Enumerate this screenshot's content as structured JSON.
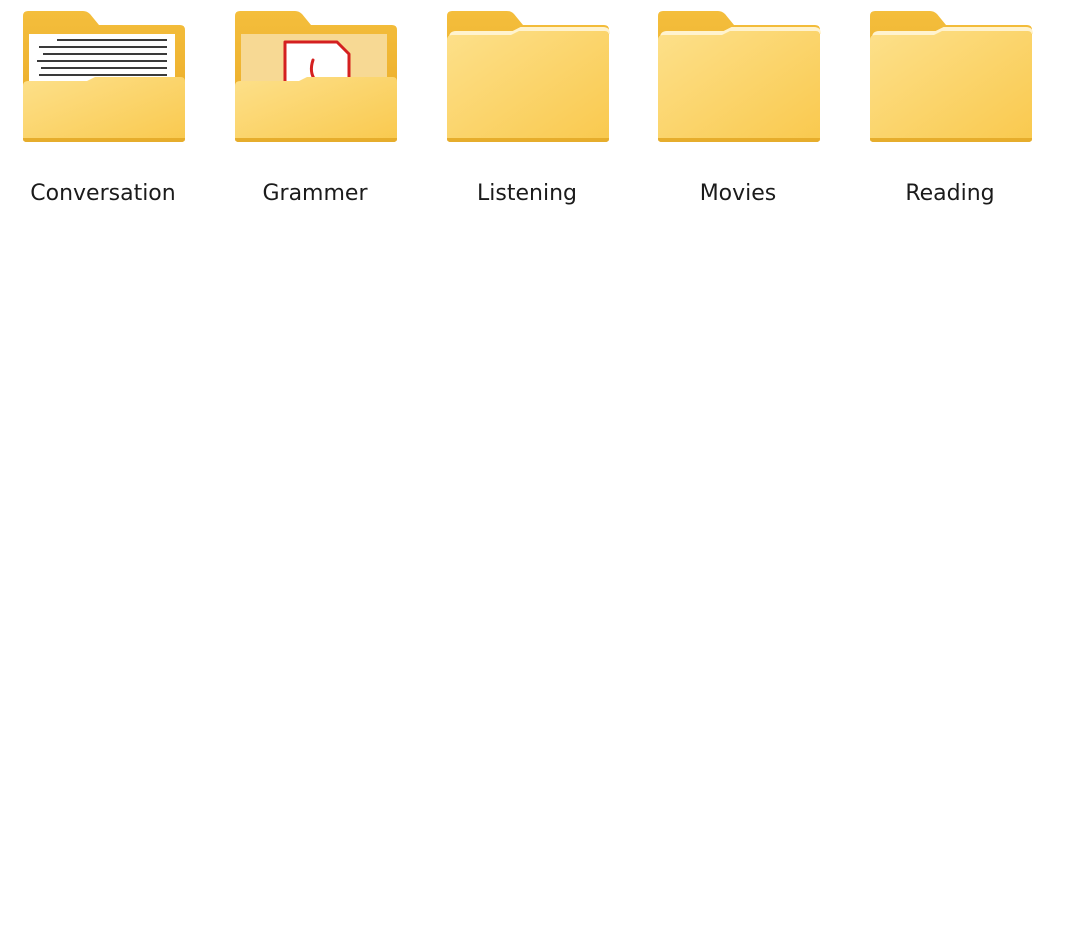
{
  "colors": {
    "folder_back": "#f0b93a",
    "folder_front": "#fcd26e",
    "folder_front_light": "#fde38f",
    "paper": "#ffffff",
    "pdf_red": "#d42020"
  },
  "folders": [
    {
      "name": "Conversation",
      "icon": "document-folder-icon"
    },
    {
      "name": "Grammer",
      "icon": "pdf-folder-icon"
    },
    {
      "name": "Listening",
      "icon": "folder-icon"
    },
    {
      "name": "Movies",
      "icon": "folder-icon"
    },
    {
      "name": "Reading",
      "icon": "folder-icon"
    }
  ]
}
